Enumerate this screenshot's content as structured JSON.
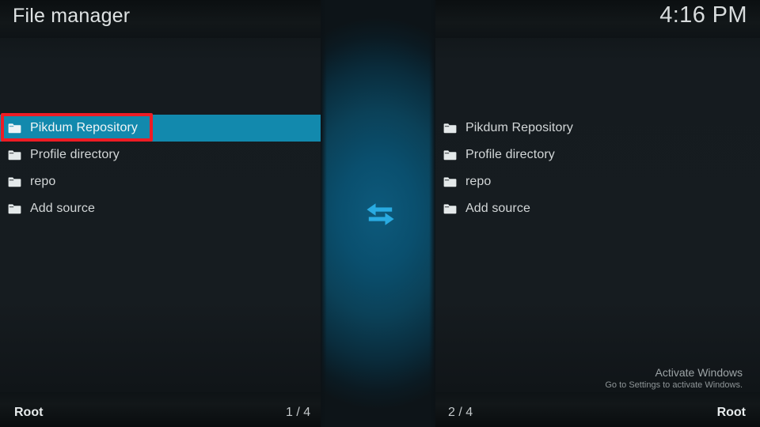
{
  "header": {
    "title": "File manager",
    "clock": "4:16 PM"
  },
  "panels": {
    "left": {
      "items": [
        {
          "label": "Pikdum Repository",
          "icon": "folder-icon",
          "selected": true
        },
        {
          "label": "Profile directory",
          "icon": "folder-icon",
          "selected": false
        },
        {
          "label": "repo",
          "icon": "folder-icon",
          "selected": false
        },
        {
          "label": "Add source",
          "icon": "folder-icon",
          "selected": false
        }
      ],
      "footer_path": "Root",
      "footer_count": "1 / 4"
    },
    "right": {
      "items": [
        {
          "label": "Pikdum Repository",
          "icon": "folder-icon",
          "selected": false
        },
        {
          "label": "Profile directory",
          "icon": "folder-icon",
          "selected": false
        },
        {
          "label": "repo",
          "icon": "folder-icon",
          "selected": false
        },
        {
          "label": "Add source",
          "icon": "folder-icon",
          "selected": false
        }
      ],
      "footer_path": "Root",
      "footer_count": "2 / 4"
    }
  },
  "center": {
    "icon": "swap-horizontal-arrows-icon"
  },
  "watermark": {
    "title": "Activate Windows",
    "subtitle": "Go to Settings to activate Windows."
  },
  "annotation": {
    "shape": "rectangle",
    "color": "#ee1c24"
  },
  "colors": {
    "selection": "#1289ad",
    "center_panel_accent": "#0d5a7c",
    "arrow_icon": "#29abe2",
    "background": "#14191c",
    "text_primary": "#d3d7d8",
    "annotation_red": "#ee1c24"
  }
}
